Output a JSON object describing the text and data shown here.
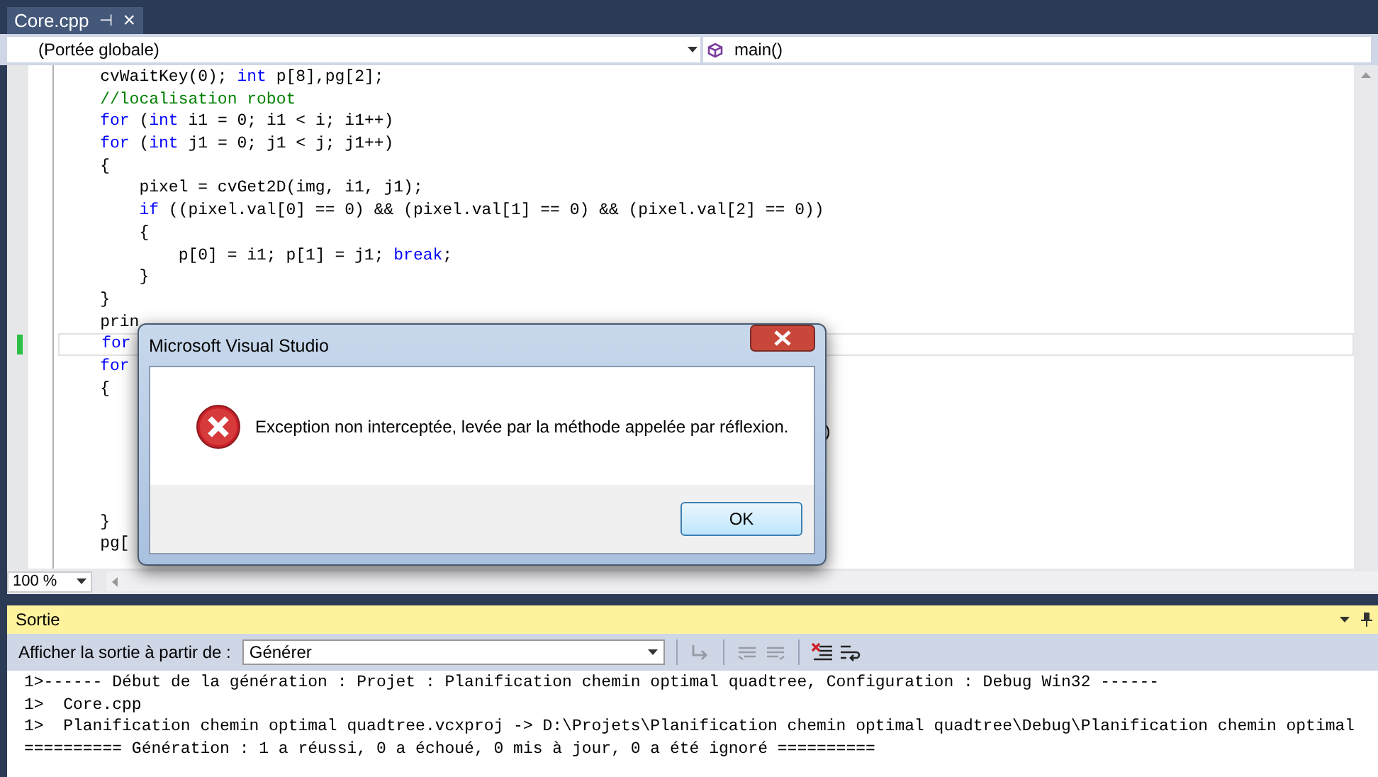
{
  "document_tab": {
    "title": "Core.cpp",
    "pin": "⊣",
    "close": "×"
  },
  "navigation": {
    "scope": "(Portée globale)",
    "member": "main()"
  },
  "code_lines": [
    {
      "current": false,
      "segments": [
        {
          "kind": "plain",
          "text": "    cvWaitKey(0); "
        },
        {
          "kind": "keyword",
          "text": "int"
        },
        {
          "kind": "plain",
          "text": " p[8],pg[2];"
        }
      ]
    },
    {
      "current": false,
      "segments": [
        {
          "kind": "comment",
          "text": "    //localisation robot"
        }
      ]
    },
    {
      "current": false,
      "segments": [
        {
          "kind": "keyword",
          "text": "    for"
        },
        {
          "kind": "plain",
          "text": " ("
        },
        {
          "kind": "keyword",
          "text": "int"
        },
        {
          "kind": "plain",
          "text": " i1 = 0; i1 < i; i1++)"
        }
      ]
    },
    {
      "current": false,
      "segments": [
        {
          "kind": "keyword",
          "text": "    for"
        },
        {
          "kind": "plain",
          "text": " ("
        },
        {
          "kind": "keyword",
          "text": "int"
        },
        {
          "kind": "plain",
          "text": " j1 = 0; j1 < j; j1++)"
        }
      ]
    },
    {
      "current": false,
      "segments": [
        {
          "kind": "plain",
          "text": "    {"
        }
      ]
    },
    {
      "current": false,
      "segments": [
        {
          "kind": "plain",
          "text": "        pixel = cvGet2D(img, i1, j1);"
        }
      ]
    },
    {
      "current": false,
      "segments": [
        {
          "kind": "keyword",
          "text": "        if"
        },
        {
          "kind": "plain",
          "text": " ((pixel.val[0] == 0) && (pixel.val[1] == 0) && (pixel.val[2] == 0))"
        }
      ]
    },
    {
      "current": false,
      "segments": [
        {
          "kind": "plain",
          "text": "        {"
        }
      ]
    },
    {
      "current": false,
      "segments": [
        {
          "kind": "plain",
          "text": "            p[0] = i1; p[1] = j1; "
        },
        {
          "kind": "keyword",
          "text": "break"
        },
        {
          "kind": "plain",
          "text": ";"
        }
      ]
    },
    {
      "current": false,
      "segments": [
        {
          "kind": "plain",
          "text": "        }"
        }
      ]
    },
    {
      "current": false,
      "segments": [
        {
          "kind": "plain",
          "text": "    }"
        }
      ]
    },
    {
      "current": false,
      "segments": [
        {
          "kind": "plain",
          "text": "    prin"
        }
      ]
    },
    {
      "current": true,
      "segments": [
        {
          "kind": "keyword",
          "text": "    for"
        }
      ]
    },
    {
      "current": false,
      "segments": [
        {
          "kind": "keyword",
          "text": "    for"
        }
      ]
    },
    {
      "current": false,
      "segments": [
        {
          "kind": "plain",
          "text": "    {"
        }
      ]
    },
    {
      "current": false
    },
    {
      "current": false,
      "segments": [
        {
          "kind": "tail",
          "text": ")"
        }
      ]
    },
    {
      "current": false
    },
    {
      "current": false
    },
    {
      "current": false
    },
    {
      "current": false,
      "segments": [
        {
          "kind": "plain",
          "text": "    }"
        }
      ]
    },
    {
      "current": false,
      "segments": [
        {
          "kind": "plain",
          "text": "    pg["
        }
      ]
    }
  ],
  "zoom": "100 %",
  "dialog": {
    "title": "Microsoft Visual Studio",
    "message": "Exception non interceptée, levée par la méthode appelée par réflexion.",
    "button": "OK"
  },
  "output_panel": {
    "title": "Sortie",
    "source_label": "Afficher la sortie à partir de :",
    "source": "Générer",
    "toolbar_buttons": [
      {
        "kind": "goto",
        "disabled": true
      },
      {
        "kind": "previous",
        "disabled": true
      },
      {
        "kind": "next",
        "disabled": true
      },
      {
        "kind": "clear",
        "disabled": false
      },
      {
        "kind": "wrap",
        "disabled": false
      }
    ],
    "lines": [
      "1>------ Début de la génération : Projet : Planification chemin optimal quadtree, Configuration : Debug Win32 ------",
      "1>  Core.cpp",
      "1>  Planification chemin optimal quadtree.vcxproj -> D:\\Projets\\Planification chemin optimal quadtree\\Debug\\Planification chemin optimal",
      "========== Génération : 1 a réussi, 0 a échoué, 0 mis à jour, 0 a été ignoré =========="
    ]
  }
}
